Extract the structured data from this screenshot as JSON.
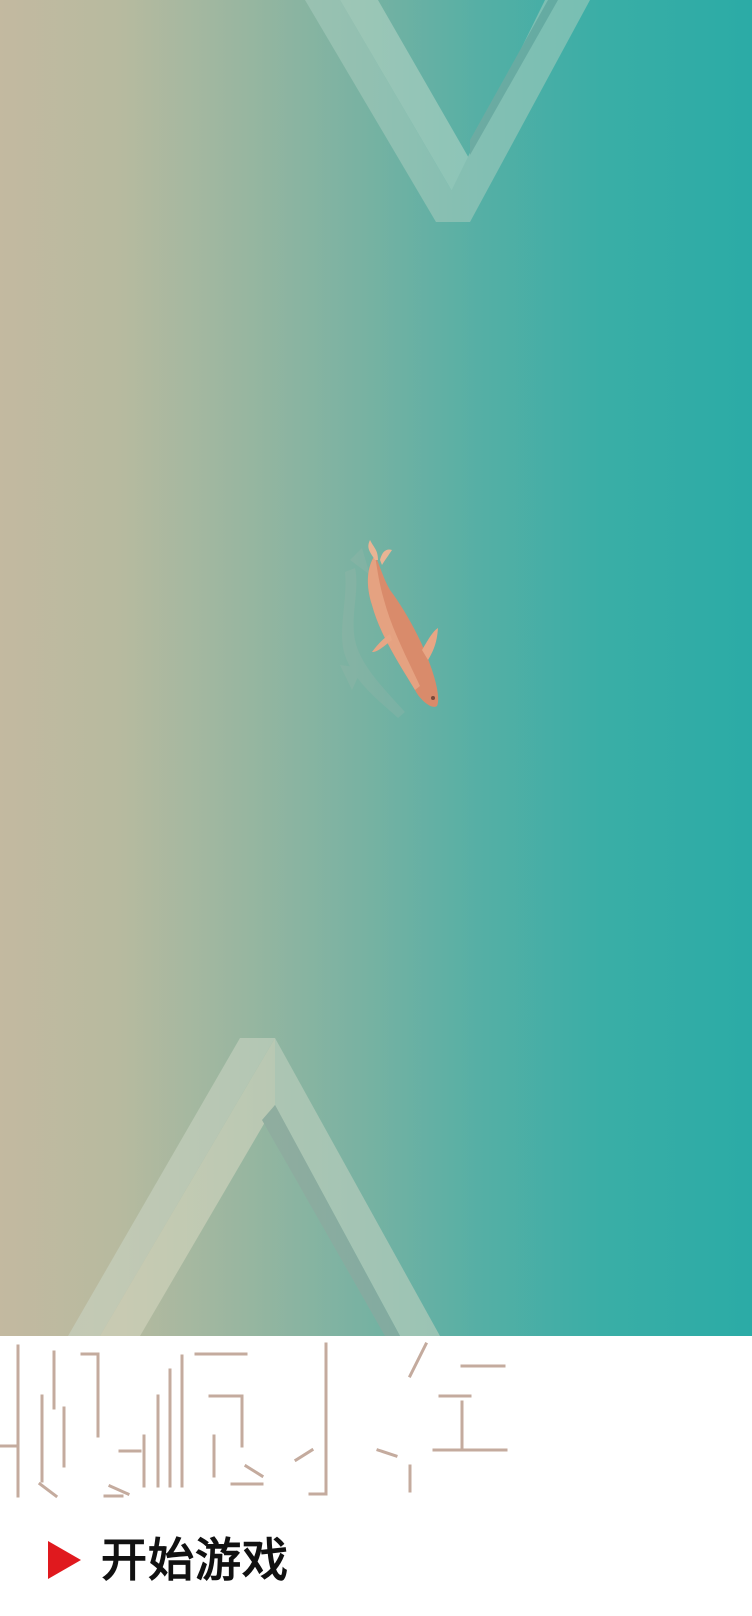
{
  "game": {
    "title_art": "title-logo-outline",
    "start_button": {
      "label": "开始游戏",
      "icon": "play-icon"
    }
  },
  "colors": {
    "water_left": "#c3b9a0",
    "water_right": "#2baba6",
    "fish": "#d98a6a",
    "play_icon": "#e0191e",
    "title_outline": "#c4ab9e"
  }
}
